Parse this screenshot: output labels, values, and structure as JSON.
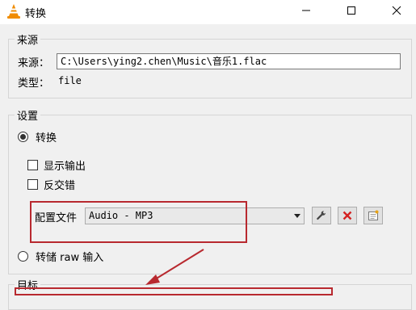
{
  "window": {
    "title": "转换",
    "icon": "vlc-cone-icon",
    "controls": [
      "minimize-icon",
      "maximize-icon",
      "close-icon"
    ]
  },
  "source": {
    "group_title": "来源",
    "source_label": "来源：",
    "source_value": "C:\\Users\\ying2.chen\\Music\\音乐1.flac",
    "type_label": "类型：",
    "type_value": "file"
  },
  "settings": {
    "group_title": "设置",
    "convert_label": "转换",
    "convert_selected": true,
    "show_output_label": "显示输出",
    "show_output_checked": false,
    "deinterlace_label": "反交错",
    "deinterlace_checked": false,
    "profile_label": "配置文件",
    "profile_value": "Audio - MP3",
    "profile_buttons": [
      "wrench-icon",
      "delete-x-icon",
      "new-profile-icon"
    ],
    "dump_raw_label": "转储 raw 输入",
    "dump_raw_selected": false
  },
  "destination": {
    "group_title": "目标"
  },
  "colors": {
    "annotation": "#b8292f",
    "delete_red": "#d42020",
    "vlc_orange": "#f08c00"
  }
}
